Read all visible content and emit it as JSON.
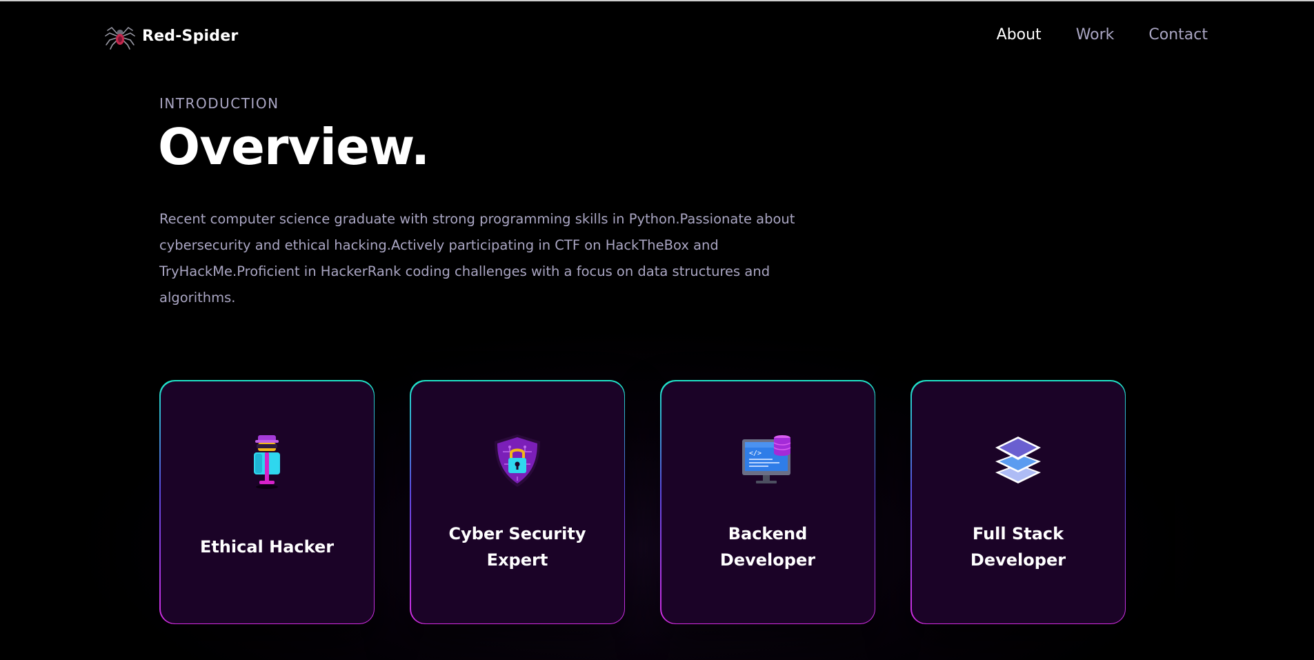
{
  "nav": {
    "brand": "Red-Spider",
    "links": [
      {
        "label": "About",
        "active": true
      },
      {
        "label": "Work",
        "active": false
      },
      {
        "label": "Contact",
        "active": false
      }
    ]
  },
  "intro": {
    "label": "INTRODUCTION",
    "title": "Overview.",
    "description": "Recent computer science graduate with strong programming skills in Python.Passionate about cybersecurity and ethical hacking.Actively participating in CTF on HackTheBox and TryHackMe.Proficient in HackerRank coding challenges with a focus on data structures and algorithms."
  },
  "cards": [
    {
      "title": "Ethical Hacker",
      "icon": "hacker-icon"
    },
    {
      "title": "Cyber Security Expert",
      "icon": "shield-lock-icon"
    },
    {
      "title": "Backend Developer",
      "icon": "monitor-database-icon"
    },
    {
      "title": "Full Stack Developer",
      "icon": "layers-icon"
    }
  ],
  "colors": {
    "background": "#000000",
    "card_background": "#1b0327",
    "secondary_text": "#aaa6c3",
    "border_top": "#1fe7c8",
    "border_bottom": "#d42de2"
  }
}
